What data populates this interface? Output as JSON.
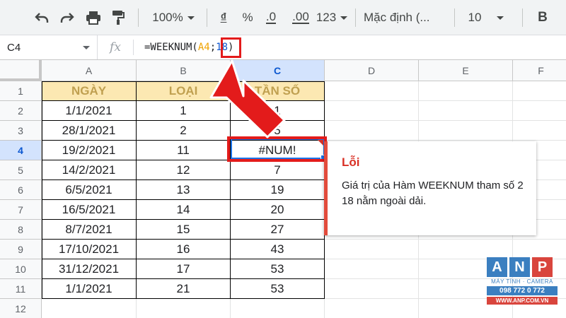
{
  "toolbar": {
    "zoom": "100%",
    "currency_symbol": "₫",
    "percent_symbol": "%",
    "decrease_decimal": ".0",
    "increase_decimal": ".00",
    "more_formats": "123",
    "font_name": "Mặc định (...",
    "font_size": "10",
    "bold": "B"
  },
  "formula_bar": {
    "cell_ref": "C4",
    "fx": "fx",
    "formula_prefix": "=WEEKNUM(",
    "formula_ref": "A4",
    "formula_sep": ";",
    "formula_num": "18",
    "formula_suffix": ")"
  },
  "grid": {
    "columns": [
      "A",
      "B",
      "C",
      "D",
      "E",
      "F"
    ],
    "rows": [
      "1",
      "2",
      "3",
      "4",
      "5",
      "6",
      "7",
      "8",
      "9",
      "10",
      "11",
      "12"
    ],
    "active_column": "C",
    "active_row": "4",
    "headers": [
      "NGÀY",
      "LOẠI",
      "TẦN SỐ"
    ],
    "data": [
      [
        "1/1/2021",
        "1",
        "1"
      ],
      [
        "28/1/2021",
        "2",
        "5"
      ],
      [
        "19/2/2021",
        "11",
        "#NUM!"
      ],
      [
        "14/2/2021",
        "12",
        "7"
      ],
      [
        "6/5/2021",
        "13",
        "19"
      ],
      [
        "16/5/2021",
        "14",
        "20"
      ],
      [
        "8/7/2021",
        "15",
        "27"
      ],
      [
        "17/10/2021",
        "16",
        "43"
      ],
      [
        "31/12/2021",
        "17",
        "53"
      ],
      [
        "1/1/2021",
        "21",
        "53"
      ]
    ]
  },
  "error_popup": {
    "title": "Lỗi",
    "message": "Giá trị của Hàm WEEKNUM tham số 2 18 nằm ngoài dải."
  },
  "logo": {
    "letters": [
      "A",
      "N",
      "P"
    ],
    "subtitle": "MÁY TÍNH · CAMERA",
    "phone": "098 772 0 772",
    "website": "WWW.ANP.COM.VN"
  },
  "colors": {
    "header_fill": "#fce8b2",
    "selection": "#1a73e8",
    "highlight": "#e31b1b",
    "error": "#d93025"
  }
}
